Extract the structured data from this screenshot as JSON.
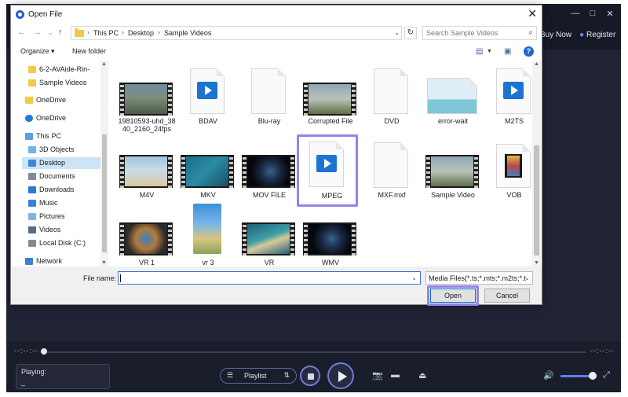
{
  "player": {
    "buy_now": "Buy Now",
    "register": "Register",
    "time_left": "--:--:--",
    "time_right": "--:--:--",
    "playing_label": "Playing:",
    "playing_value": "_",
    "playlist_label": "Playlist",
    "volume_level": 0.8
  },
  "dialog": {
    "title": "Open File",
    "breadcrumb": [
      "This PC",
      "Desktop",
      "Sample Videos"
    ],
    "search_placeholder": "Search Sample Videos",
    "organize": "Organize ▾",
    "new_folder": "New folder",
    "nav_items": [
      {
        "label": "6-2-AVAide-Rin-",
        "type": "folder"
      },
      {
        "label": "Sample Videos",
        "type": "folder"
      },
      {
        "label": "OneDrive",
        "type": "folder"
      },
      {
        "label": "OneDrive",
        "type": "cloud"
      },
      {
        "label": "This PC",
        "type": "pc"
      },
      {
        "label": "3D Objects",
        "type": "3d"
      },
      {
        "label": "Desktop",
        "type": "desktop",
        "selected": true
      },
      {
        "label": "Documents",
        "type": "docs"
      },
      {
        "label": "Downloads",
        "type": "downloads"
      },
      {
        "label": "Music",
        "type": "music"
      },
      {
        "label": "Pictures",
        "type": "pictures"
      },
      {
        "label": "Videos",
        "type": "videos"
      },
      {
        "label": "Local Disk (C:)",
        "type": "disk"
      },
      {
        "label": "Network",
        "type": "network"
      }
    ],
    "files": [
      {
        "name": "19810593-uhd_3840_2160_24fps",
        "kind": "film",
        "thumb": "street"
      },
      {
        "name": "BDAV",
        "kind": "doc-play"
      },
      {
        "name": "Blu-ray",
        "kind": "doc"
      },
      {
        "name": "Corrupted File",
        "kind": "film",
        "thumb": "birds"
      },
      {
        "name": "DVD",
        "kind": "doc"
      },
      {
        "name": "error-wait",
        "kind": "image"
      },
      {
        "name": "M2TS",
        "kind": "doc-play"
      },
      {
        "name": "M4V",
        "kind": "film",
        "thumb": "beach"
      },
      {
        "name": "MKV",
        "kind": "film",
        "thumb": "ocean"
      },
      {
        "name": "MOV FILE",
        "kind": "film",
        "thumb": "earth"
      },
      {
        "name": "MPEG",
        "kind": "doc-play",
        "selected": true
      },
      {
        "name": "MXF.mxf",
        "kind": "doc"
      },
      {
        "name": "Sample Video",
        "kind": "film",
        "thumb": "birds"
      },
      {
        "name": "VOB",
        "kind": "vob"
      },
      {
        "name": "VR 1",
        "kind": "film",
        "thumb": "vr"
      },
      {
        "name": "vr 3",
        "kind": "vertical"
      },
      {
        "name": "VR",
        "kind": "film",
        "thumb": "island"
      },
      {
        "name": "WMV",
        "kind": "film",
        "thumb": "earth"
      }
    ],
    "file_name_label": "File name:",
    "file_name_value": "",
    "filter": "Media Files(*.ts;*.mts;*.m2ts;*.t",
    "open_label": "Open",
    "cancel_label": "Cancel"
  },
  "colors": {
    "highlight": "#8e86e8",
    "player_bg": "#1b1e2c",
    "accent": "#5e7bff"
  }
}
